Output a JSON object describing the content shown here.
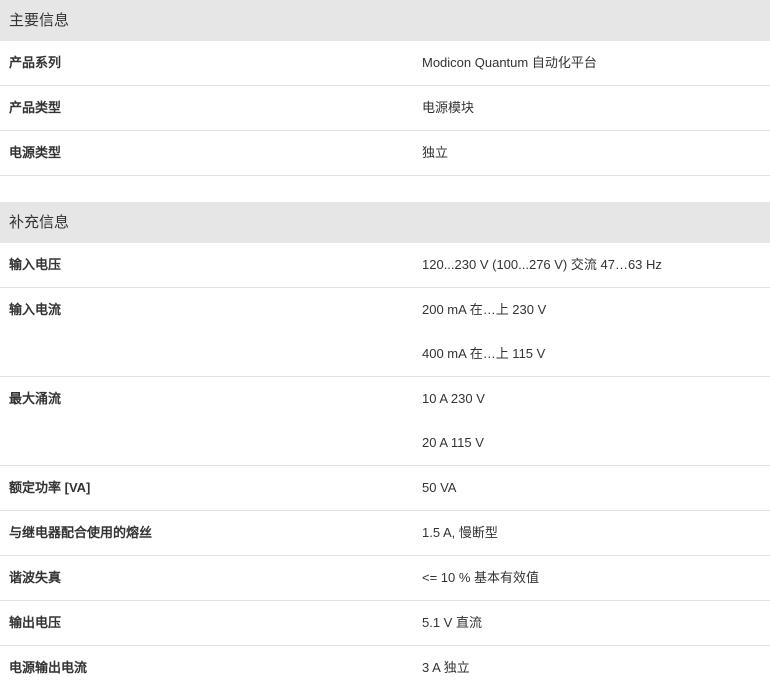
{
  "sections": [
    {
      "title": "主要信息",
      "rows": [
        {
          "label": "产品系列",
          "values": [
            "Modicon Quantum 自动化平台"
          ]
        },
        {
          "label": "产品类型",
          "values": [
            "电源模块"
          ]
        },
        {
          "label": "电源类型",
          "values": [
            "独立"
          ]
        }
      ]
    },
    {
      "title": "补充信息",
      "rows": [
        {
          "label": "输入电压",
          "values": [
            "120...230 V (100...276 V) 交流 47…63 Hz"
          ]
        },
        {
          "label": "输入电流",
          "values": [
            "200 mA 在…上 230 V",
            "400 mA 在…上 115 V"
          ]
        },
        {
          "label": "最大涌流",
          "values": [
            "10 A 230 V",
            "20 A 115 V"
          ]
        },
        {
          "label": "额定功率 [VA]",
          "values": [
            "50 VA"
          ]
        },
        {
          "label": "与继电器配合使用的熔丝",
          "values": [
            "1.5 A, 慢断型"
          ]
        },
        {
          "label": "谐波失真",
          "values": [
            "<= 10 % 基本有效值"
          ]
        },
        {
          "label": "输出电压",
          "values": [
            "5.1 V 直流"
          ]
        },
        {
          "label": "电源输出电流",
          "values": [
            "3 A 独立"
          ]
        }
      ]
    }
  ]
}
